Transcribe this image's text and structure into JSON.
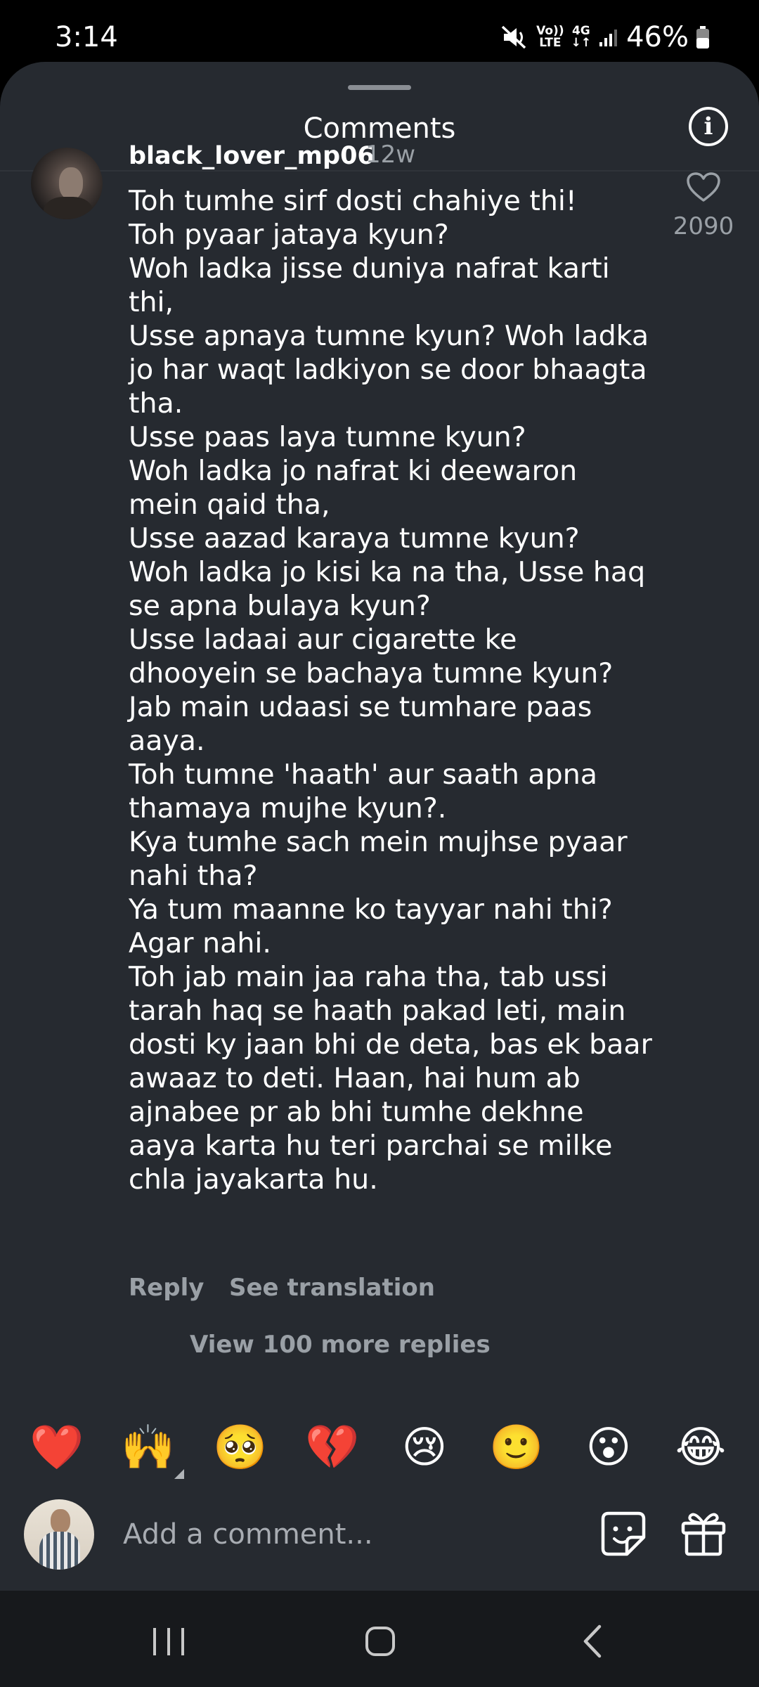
{
  "status_bar": {
    "time": "3:14",
    "battery": "46%",
    "volte_top": "Vo))",
    "volte_bottom": "LTE",
    "network": "4G"
  },
  "header": {
    "title": "Comments"
  },
  "comment": {
    "username": "black_lover_mp06",
    "time": "12w",
    "text": "Toh tumhe sirf dosti chahiye thi!\nToh pyaar jataya kyun?\nWoh ladka jisse duniya nafrat karti thi,\nUsse apnaya tumne kyun? Woh ladka jo har waqt ladkiyon se door bhaagta tha.\nUsse paas laya tumne kyun?\nWoh ladka jo nafrat ki deewaron mein qaid tha,\nUsse aazad karaya tumne kyun?\nWoh ladka jo kisi ka na tha, Usse haq se apna bulaya kyun?\nUsse ladaai aur cigarette ke dhooyein se bachaya tumne kyun?\nJab main udaasi se tumhare paas aaya.\nToh tumne 'haath' aur saath apna thamaya mujhe kyun?.\nKya tumhe sach mein mujhse pyaar nahi tha?\nYa tum maanne ko tayyar nahi thi?\nAgar nahi.\nToh jab main jaa raha tha, tab ussi tarah haq se haath pakad leti, main dosti ky jaan bhi de deta, bas ek baar awaaz to deti. Haan, hai hum ab ajnabee pr ab bhi tumhe dekhne aaya karta hu teri parchai se milke chla jayakarta hu.",
    "like_count": "2090",
    "reply_label": "Reply",
    "translate_label": "See translation",
    "more_replies_label": "View 100 more replies"
  },
  "emoji_bar": [
    "❤️",
    "🙌",
    "🥺",
    "💔",
    "😢",
    "🙂",
    "😮",
    "😂"
  ],
  "composer": {
    "placeholder": "Add a comment..."
  },
  "icons": {
    "info": "info-icon",
    "like": "heart-outline-icon",
    "sticker": "sticker-icon",
    "gift": "gift-icon",
    "nav": [
      "recents-icon",
      "home-icon",
      "back-icon"
    ]
  }
}
